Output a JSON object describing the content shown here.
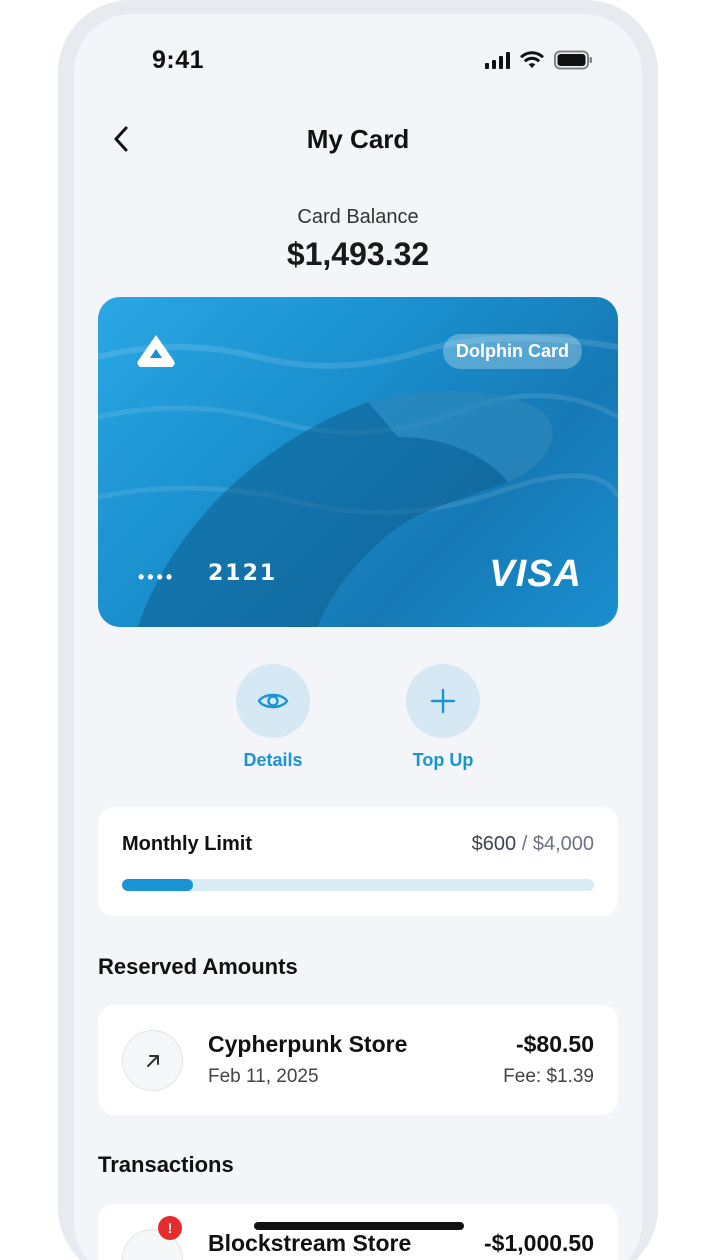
{
  "status_bar": {
    "time": "9:41"
  },
  "header": {
    "title": "My Card"
  },
  "balance": {
    "label": "Card Balance",
    "value": "$1,493.32"
  },
  "card": {
    "badge": "Dolphin Card",
    "masked_dots": "••••",
    "last_four": "2121",
    "brand": "VISA",
    "gradient_colors": [
      "#2aa7e4",
      "#1a8fcd",
      "#1679b5"
    ]
  },
  "actions": [
    {
      "label": "Details",
      "icon": "eye-icon"
    },
    {
      "label": "Top Up",
      "icon": "plus-icon"
    }
  ],
  "monthly_limit": {
    "title": "Monthly Limit",
    "spent": "$600",
    "separator": "/",
    "limit": "$4,000",
    "progress_fraction": 0.15
  },
  "reserved": {
    "section_title": "Reserved Amounts",
    "items": [
      {
        "name": "Cypherpunk Store",
        "date": "Feb 11, 2025",
        "amount": "-$80.50",
        "fee": "Fee: $1.39",
        "icon": "arrow-up-right-icon"
      }
    ]
  },
  "transactions": {
    "section_title": "Transactions",
    "items": [
      {
        "name": "Blockstream Store",
        "amount": "-$1,000.50",
        "icon": "alert-icon"
      }
    ]
  },
  "colors": {
    "accent": "#1a95d3",
    "accent_light": "#d5e8f4",
    "screen_bg": "#f3f5f8",
    "alert": "#e52d2d"
  }
}
